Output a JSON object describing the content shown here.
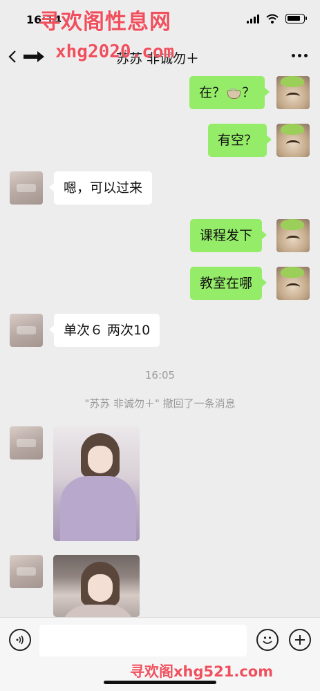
{
  "status_bar": {
    "time": "16:14"
  },
  "watermarks": {
    "top": "寻欢阁性息网",
    "mid": "xhg2020.com",
    "bottom": "寻欢阁xhg521.com"
  },
  "nav": {
    "title": "苏苏 非诚勿＋"
  },
  "messages": [
    {
      "side": "out",
      "text_before": "在？",
      "emoji": "tea-icon",
      "text_after": "？"
    },
    {
      "side": "out",
      "text": "有空？"
    },
    {
      "side": "in",
      "text": "嗯，可以过来"
    },
    {
      "side": "out",
      "text": "课程发下"
    },
    {
      "side": "out",
      "text": "教室在哪"
    },
    {
      "side": "in",
      "text": "单次６ 两次10"
    }
  ],
  "timestamp": "16:05",
  "system_message": "\"苏苏 非诚勿＋\" 撤回了一条消息",
  "input_bar": {
    "placeholder": ""
  },
  "colors": {
    "outgoing_bubble": "#95ec69",
    "incoming_bubble": "#ffffff",
    "background": "#ededed",
    "watermark": "#f0505e"
  }
}
